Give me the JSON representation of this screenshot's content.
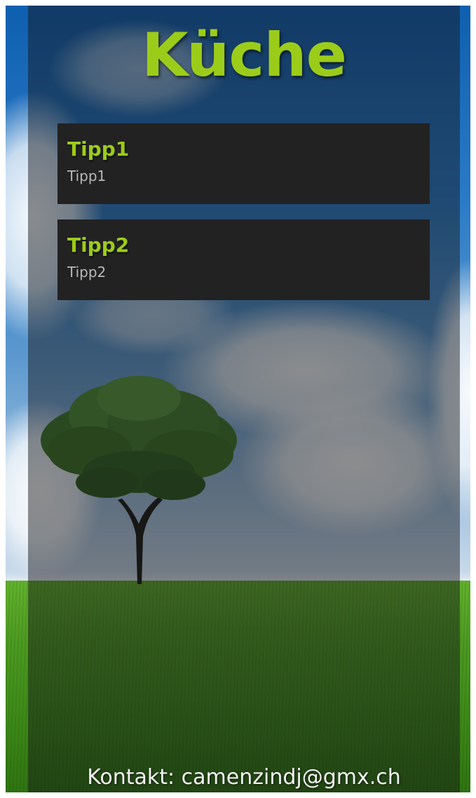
{
  "screen": {
    "title": "Küche",
    "accent_color": "#9ccc1a",
    "card_background": "#222222"
  },
  "tips": [
    {
      "title": "Tipp1",
      "subtitle": "Tipp1"
    },
    {
      "title": "Tipp2",
      "subtitle": "Tipp2"
    }
  ],
  "footer": {
    "contact": "Kontakt: camenzindj@gmx.ch"
  }
}
